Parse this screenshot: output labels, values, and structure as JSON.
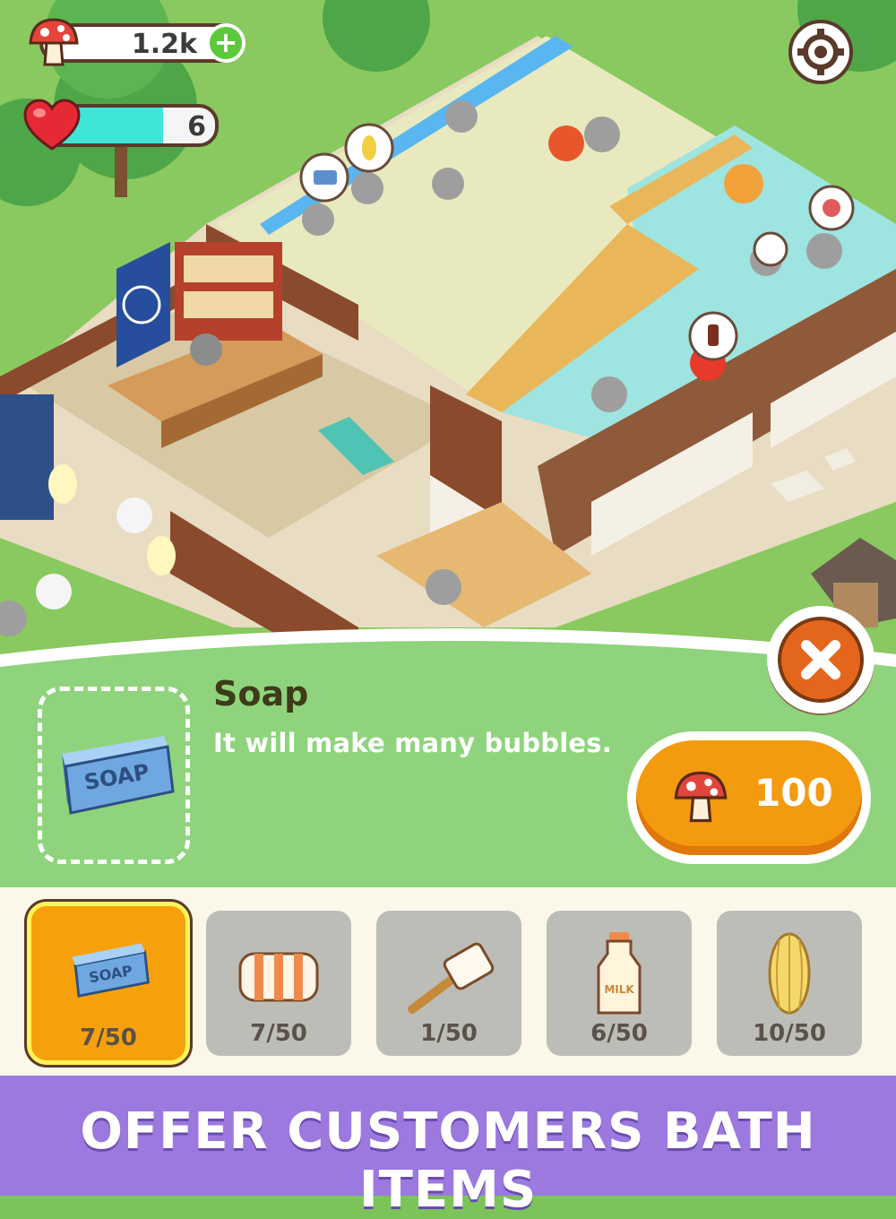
{
  "hud": {
    "currency": {
      "icon": "mushroom-icon",
      "value": "1.2k",
      "add_icon": "plus-icon"
    },
    "hearts": {
      "icon": "heart-icon",
      "value": "6",
      "fill_fraction": 0.7
    },
    "settings_icon": "gear-icon"
  },
  "item_detail": {
    "icon": "soap-icon",
    "icon_text": "SOAP",
    "title": "Soap",
    "description": "It will make many bubbles.",
    "price": "100",
    "price_icon": "mushroom-icon",
    "close_icon": "close-icon"
  },
  "items": [
    {
      "name": "soap",
      "icon": "soap-icon",
      "icon_text": "SOAP",
      "count": "7/50",
      "selected": true
    },
    {
      "name": "towel",
      "icon": "towel-icon",
      "count": "7/50",
      "selected": false
    },
    {
      "name": "bath-brush",
      "icon": "brush-icon",
      "count": "1/50",
      "selected": false
    },
    {
      "name": "milk",
      "icon": "milk-icon",
      "icon_text": "MILK",
      "count": "6/50",
      "selected": false
    },
    {
      "name": "loofah",
      "icon": "loofah-icon",
      "count": "10/50",
      "selected": false
    }
  ],
  "banner": {
    "text": "OFFER CUSTOMERS BATH ITEMS"
  },
  "colors": {
    "panel_green": "#8fd47c",
    "accent_orange": "#f49a0f",
    "banner_purple": "#9b79de",
    "close_orange": "#e4661d"
  }
}
